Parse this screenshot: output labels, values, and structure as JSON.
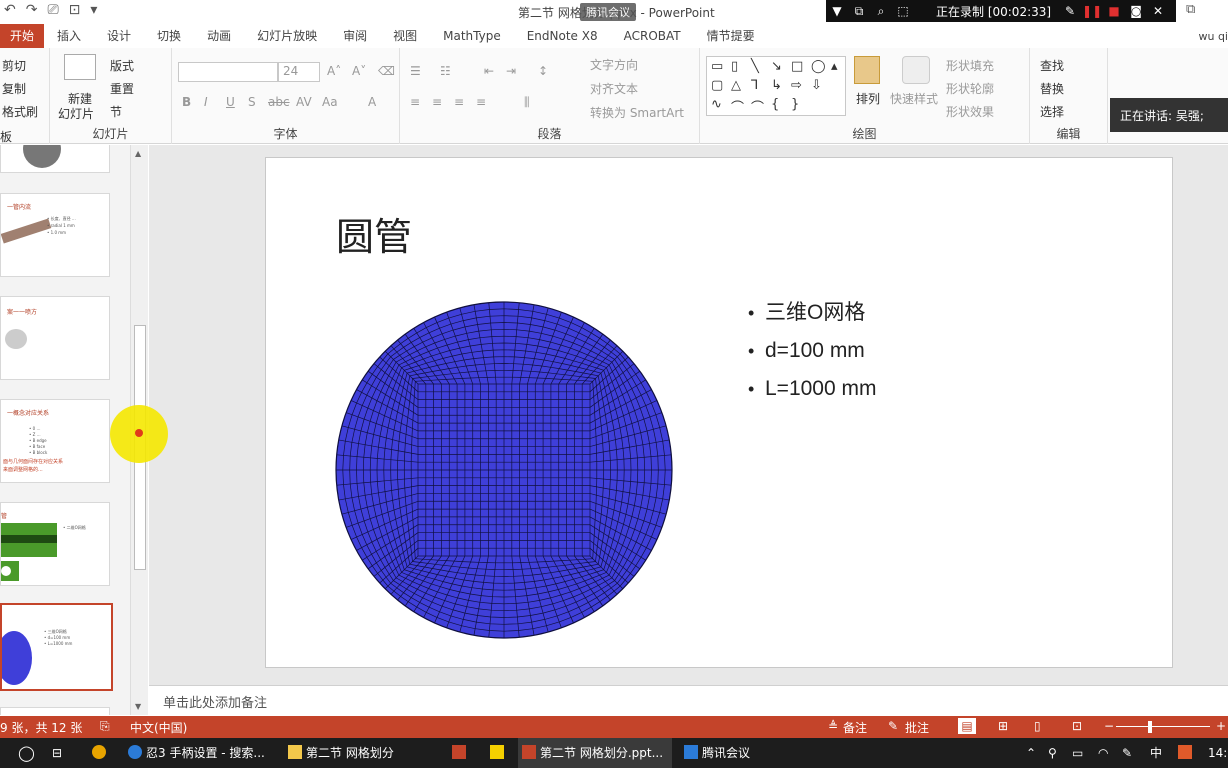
{
  "title_bar": {
    "document_title": "第二节 网格划分.pptx - PowerPoint",
    "meeting_badge": "腾讯会议",
    "recording_status": "正在录制 [00:02:33]"
  },
  "ribbon_tabs": [
    "开始",
    "插入",
    "设计",
    "切换",
    "动画",
    "幻灯片放映",
    "审阅",
    "视图",
    "MathType",
    "EndNote X8",
    "ACROBAT",
    "情节提要"
  ],
  "active_tab": "开始",
  "user_name": "wu qi",
  "clipboard": {
    "cut": "剪切",
    "copy": "复制",
    "format_painter": "格式刷",
    "label": "板"
  },
  "slides_group": {
    "new_slide": "新建",
    "new_slide2": "幻灯片",
    "layout": "版式",
    "reset": "重置",
    "section": "节",
    "label": "幻灯片"
  },
  "font_group": {
    "font_size": "24",
    "label": "字体"
  },
  "paragraph_group": {
    "text_direction": "文字方向",
    "align_text": "对齐文本",
    "convert_smartart": "转换为 SmartArt",
    "label": "段落"
  },
  "drawing_group": {
    "arrange": "排列",
    "quick_styles": "快速样式",
    "shape_fill": "形状填充",
    "shape_outline": "形状轮廓",
    "shape_effects": "形状效果",
    "label": "绘图"
  },
  "editing_group": {
    "find": "查找",
    "replace": "替换",
    "select": "选择",
    "label": "编辑"
  },
  "speaker_overlay": "正在讲话: 吴强;",
  "thumbnails": [
    {
      "title": "一管内流",
      "snippets": [
        "• 长度、直径 ...",
        "• radial  1 mm",
        "• 1.0 mm"
      ]
    },
    {
      "title": "案一一喷方",
      "snippets": []
    },
    {
      "title": "一概念对应关系",
      "snippets": [
        "• 0 …",
        "• Z …",
        "• B edge",
        "• B face",
        "• B block",
        "面与几何面间存在对应关系",
        "来面调整网格的..."
      ]
    },
    {
      "title": "管",
      "snippets": [
        "• 二维O网格"
      ]
    },
    {
      "title": "",
      "snippets": [
        "• 三维O网格",
        "• d=100 mm",
        "• L=1000 mm"
      ]
    }
  ],
  "slide": {
    "title": "圆管",
    "bullets": [
      "三维O网格",
      "d=100 mm",
      "L=1000 mm"
    ],
    "mesh_color": "#3f3fd9"
  },
  "notes_placeholder": "单击此处添加备注",
  "status_bar": {
    "slide_counter": "9 张，共 12 张",
    "language": "中文(中国)",
    "notes_btn": "备注",
    "comments_btn": "批注"
  },
  "taskbar": {
    "items": [
      "忍3 手柄设置 - 搜索...",
      "第二节 网格划分",
      "第二节 网格划分.ppt...",
      "腾讯会议"
    ],
    "tray_ime": "中",
    "clock": "14:"
  },
  "colors": {
    "accent": "#c4442a",
    "mesh": "#3f3fd9"
  }
}
